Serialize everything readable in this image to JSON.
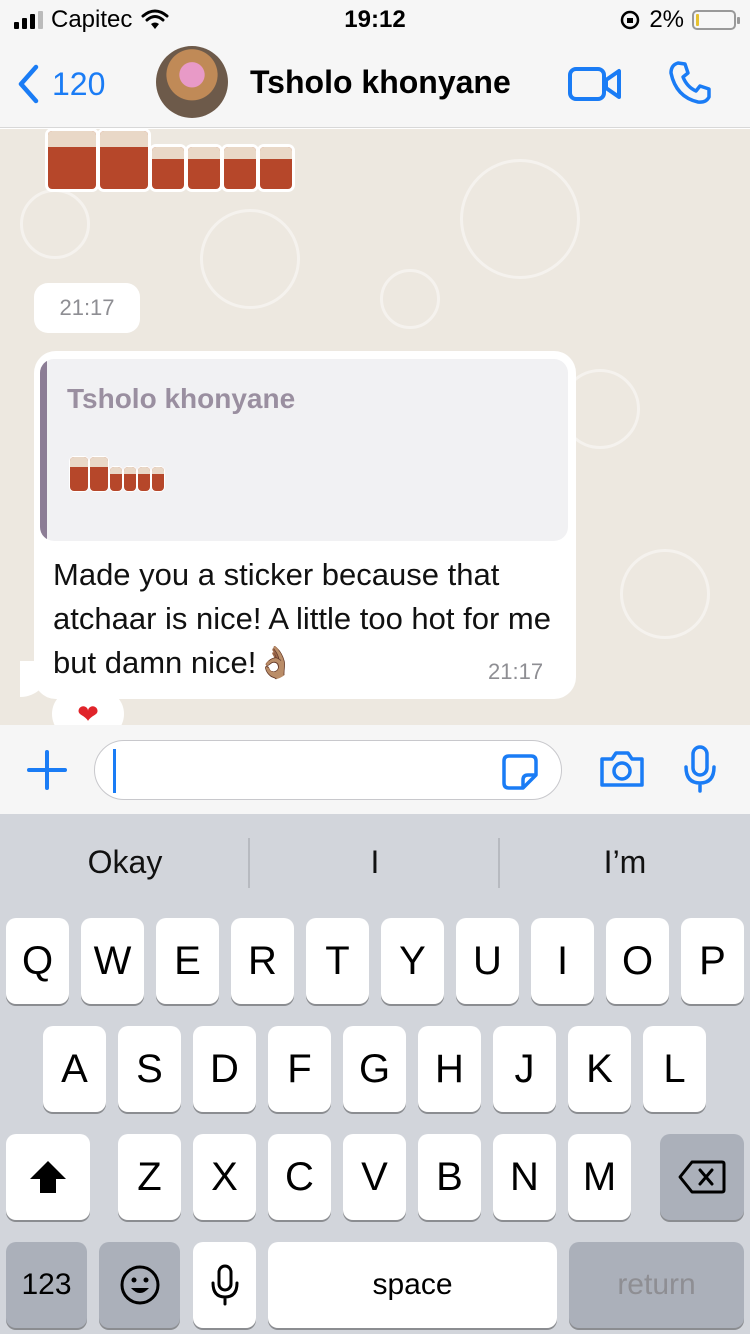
{
  "status": {
    "carrier": "Capitec",
    "time": "19:12",
    "battery": "2%"
  },
  "header": {
    "back_count": "120",
    "contact_name": "Tsholo khonyane"
  },
  "chat": {
    "time_chip": "21:17",
    "message": {
      "reply_name": "Tsholo khonyane",
      "text": "Made you a sticker because that atchaar is nice! A little too hot for me but damn nice!👌🏽",
      "time": "21:17",
      "reaction": "❤"
    }
  },
  "input": {
    "value": "",
    "placeholder": ""
  },
  "keyboard": {
    "suggestions": [
      "Okay",
      "I",
      "I’m"
    ],
    "row1": [
      "Q",
      "W",
      "E",
      "R",
      "T",
      "Y",
      "U",
      "I",
      "O",
      "P"
    ],
    "row2": [
      "A",
      "S",
      "D",
      "F",
      "G",
      "H",
      "J",
      "K",
      "L"
    ],
    "row3": [
      "Z",
      "X",
      "C",
      "V",
      "B",
      "N",
      "M"
    ],
    "numbers_label": "123",
    "space_label": "space",
    "return_label": "return"
  },
  "colors": {
    "accent": "#1a7cf5",
    "chat_bg": "#ede8e0",
    "keyboard_bg": "#d2d5db",
    "heart": "#e0242a"
  },
  "icons": [
    "signal-icon",
    "wifi-icon",
    "orientation-lock-icon",
    "battery-icon",
    "chevron-left-icon",
    "video-call-icon",
    "phone-icon",
    "plus-icon",
    "sticker-icon",
    "camera-icon",
    "microphone-icon",
    "shift-icon",
    "delete-icon",
    "emoji-icon",
    "dictation-icon"
  ]
}
